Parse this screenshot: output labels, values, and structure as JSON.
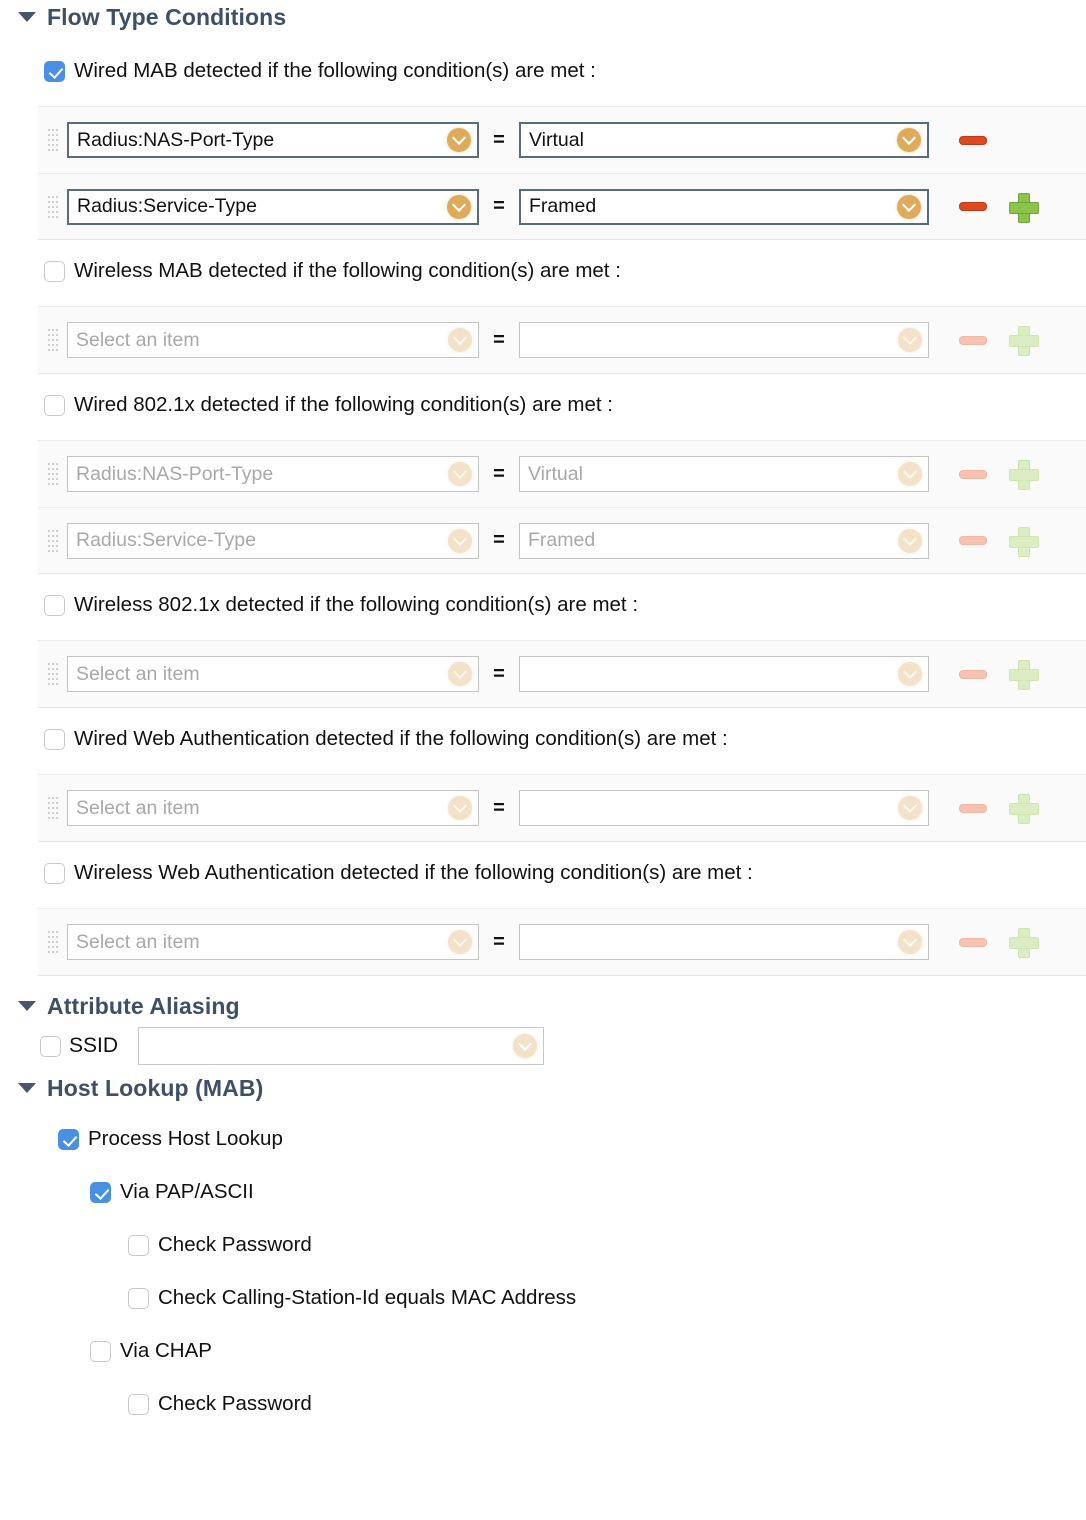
{
  "sections": {
    "flow_type": {
      "title": "Flow Type Conditions",
      "toggle_icon": "triangle-down-icon",
      "groups": [
        {
          "id": "wired-mab",
          "label": "Wired MAB detected if the following condition(s) are met :",
          "checked": true,
          "enabled": true,
          "rows": [
            {
              "attribute": "Radius:NAS-Port-Type",
              "operator": "=",
              "value": "Virtual",
              "has_remove": true,
              "has_add": false
            },
            {
              "attribute": "Radius:Service-Type",
              "operator": "=",
              "value": "Framed",
              "has_remove": true,
              "has_add": true
            }
          ]
        },
        {
          "id": "wireless-mab",
          "label": "Wireless MAB detected if the following condition(s) are met :",
          "checked": false,
          "enabled": false,
          "rows": [
            {
              "attribute": "Select an item",
              "operator": "=",
              "value": "",
              "has_remove": true,
              "has_add": true
            }
          ]
        },
        {
          "id": "wired-8021x",
          "label": "Wired 802.1x detected if the following condition(s) are met :",
          "checked": false,
          "enabled": false,
          "rows": [
            {
              "attribute": "Radius:NAS-Port-Type",
              "operator": "=",
              "value": "Virtual",
              "has_remove": true,
              "has_add": true
            },
            {
              "attribute": "Radius:Service-Type",
              "operator": "=",
              "value": "Framed",
              "has_remove": true,
              "has_add": true
            }
          ]
        },
        {
          "id": "wireless-8021x",
          "label": "Wireless 802.1x detected if the following condition(s) are met :",
          "checked": false,
          "enabled": false,
          "rows": [
            {
              "attribute": "Select an item",
              "operator": "=",
              "value": "",
              "has_remove": true,
              "has_add": true
            }
          ]
        },
        {
          "id": "wired-web-auth",
          "label": "Wired Web Authentication detected if the following condition(s) are met :",
          "checked": false,
          "enabled": false,
          "rows": [
            {
              "attribute": "Select an item",
              "operator": "=",
              "value": "",
              "has_remove": true,
              "has_add": true
            }
          ]
        },
        {
          "id": "wireless-web-auth",
          "label": "Wireless Web Authentication detected if the following condition(s) are met :",
          "checked": false,
          "enabled": false,
          "rows": [
            {
              "attribute": "Select an item",
              "operator": "=",
              "value": "",
              "has_remove": true,
              "has_add": true
            }
          ]
        }
      ]
    },
    "attribute_aliasing": {
      "title": "Attribute Aliasing",
      "toggle_icon": "triangle-down-icon",
      "ssid": {
        "label": "SSID",
        "checked": false,
        "value": "",
        "dropdown_icon": "chevron-down-circle-icon"
      }
    },
    "host_lookup": {
      "title": "Host Lookup (MAB)",
      "toggle_icon": "triangle-down-icon",
      "items": [
        {
          "label": "Process Host Lookup",
          "checked": true,
          "indent": 1
        },
        {
          "label": "Via PAP/ASCII",
          "checked": true,
          "indent": 2
        },
        {
          "label": "Check Password",
          "checked": false,
          "indent": 3
        },
        {
          "label": "Check Calling-Station-Id equals MAC Address",
          "checked": false,
          "indent": 3
        },
        {
          "label": "Via CHAP",
          "checked": false,
          "indent": 2
        },
        {
          "label": "Check Password",
          "checked": false,
          "indent": 3
        }
      ]
    }
  },
  "colors": {
    "heading": "#3d5068",
    "checkbox_checked": "#4a90e2",
    "dropdown_circle": "#ddab5b",
    "remove_icon": "#e0491f",
    "add_icon": "#8cc44b",
    "row_background": "#fafafa"
  },
  "icons": {
    "drag_handle": "drag-handle-icon",
    "remove": "remove-row-icon",
    "add": "add-row-icon",
    "dropdown": "chevron-down-circle-icon"
  }
}
